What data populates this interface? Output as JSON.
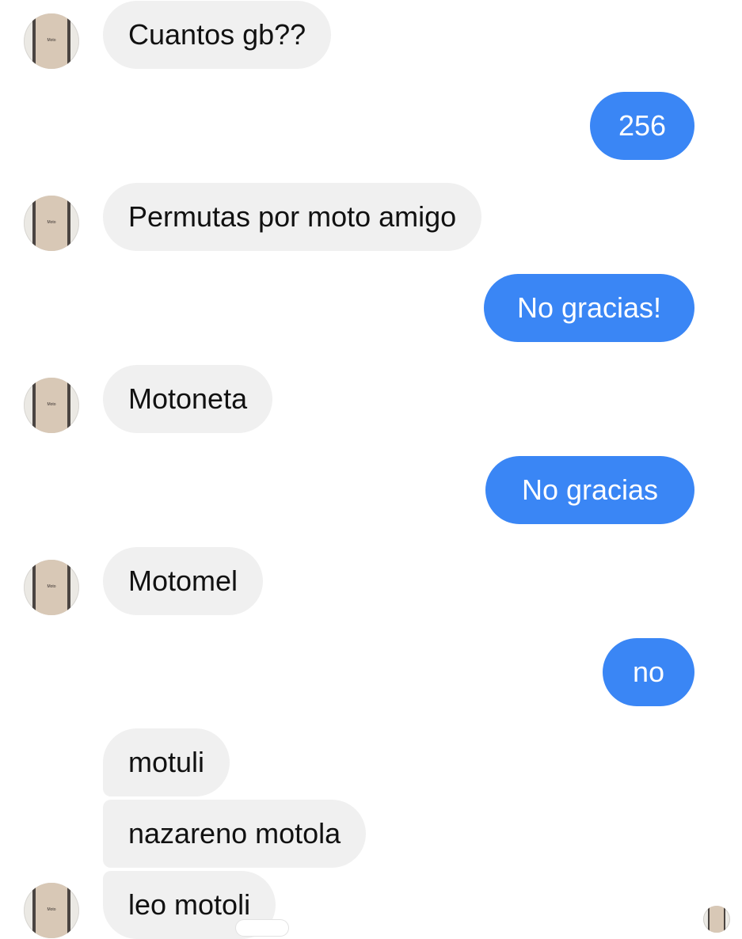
{
  "contact": {
    "avatar_icon": "contact-avatar-phone-image",
    "avatar_caption": "Moto"
  },
  "messages": [
    {
      "from": "them",
      "text": "Cuantos gb??"
    },
    {
      "from": "me",
      "text": "256"
    },
    {
      "from": "them",
      "text": "Permutas por moto amigo"
    },
    {
      "from": "me",
      "text": "No gracias!"
    },
    {
      "from": "them",
      "text": "Motoneta"
    },
    {
      "from": "me",
      "text": "No gracias"
    },
    {
      "from": "them",
      "text": "Motomel"
    },
    {
      "from": "me",
      "text": "no"
    },
    {
      "from": "them",
      "text": "motuli"
    },
    {
      "from": "them",
      "text": "nazareno motola"
    },
    {
      "from": "them",
      "text": "leo motoli"
    }
  ],
  "read_receipt": {
    "icon": "seen-avatar"
  },
  "colors": {
    "outgoing_bubble": "#3a86f5",
    "incoming_bubble": "#f0f0f0",
    "background": "#ffffff"
  }
}
